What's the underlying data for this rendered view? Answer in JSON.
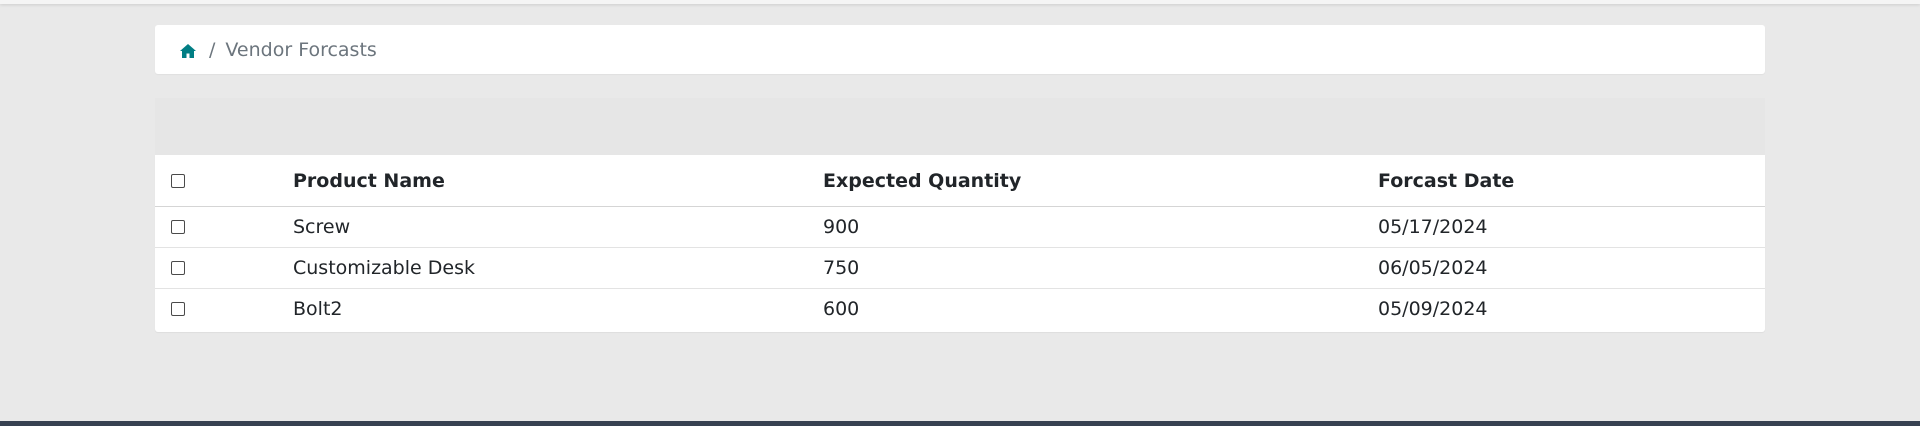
{
  "breadcrumb": {
    "home_icon": "home-icon",
    "separator": "/",
    "current": "Vendor Forcasts"
  },
  "table": {
    "columns": {
      "name": "Product Name",
      "qty": "Expected Quantity",
      "date": "Forcast Date"
    },
    "rows": [
      {
        "name": "Screw",
        "qty": "900",
        "date": "05/17/2024"
      },
      {
        "name": "Customizable Desk",
        "qty": "750",
        "date": "06/05/2024"
      },
      {
        "name": "Bolt2",
        "qty": "600",
        "date": "05/09/2024"
      }
    ]
  },
  "colors": {
    "accent": "#017e84",
    "background": "#e9e9e9",
    "bottom_bar": "#374151"
  }
}
